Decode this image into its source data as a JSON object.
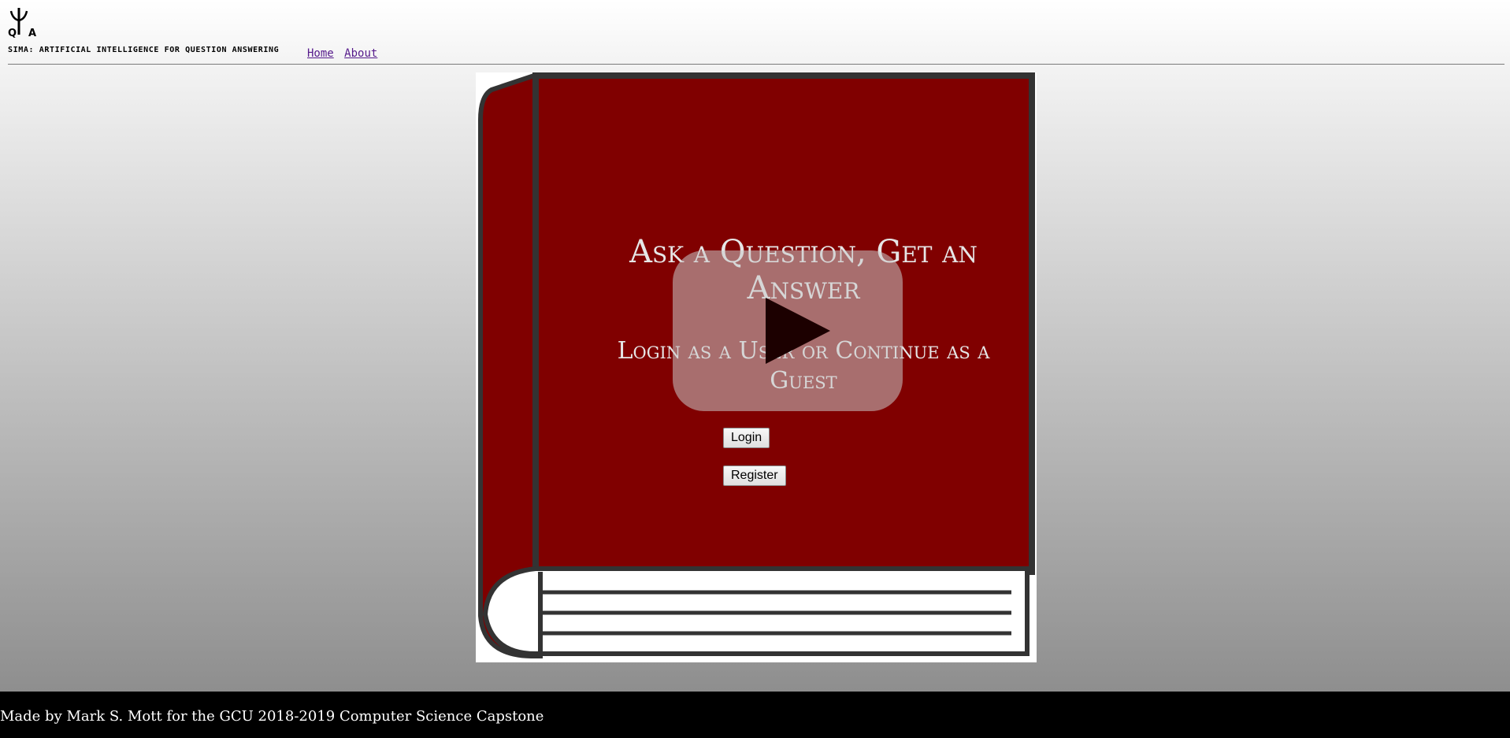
{
  "header": {
    "logo_icon": "psi-qa-logo-icon",
    "brand": "SIMA: ARTIFICIAL INTELLIGENCE FOR QUESTION ANSWERING",
    "nav": {
      "home": "Home",
      "about": "About"
    }
  },
  "hero": {
    "headline": "Ask a Question, Get an Answer",
    "subtitle": "Login as a User or Continue as a Guest",
    "play_icon": "play-icon",
    "book_color": "#800000"
  },
  "buttons": {
    "login": "Login",
    "register": "Register"
  },
  "footer": {
    "text": "Made by Mark S. Mott for the GCU 2018-2019 Computer Science Capstone"
  }
}
